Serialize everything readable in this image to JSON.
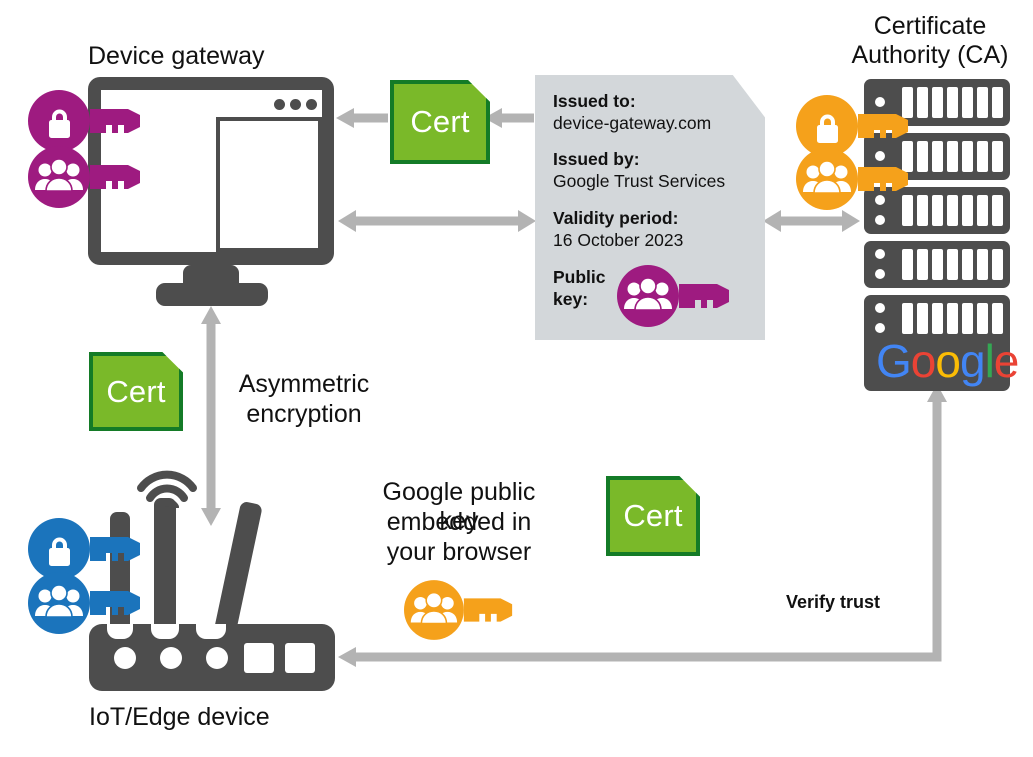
{
  "diagram": {
    "title_device_gateway": "Device gateway",
    "title_ca_line1": "Certificate",
    "title_ca_line2": "Authority (CA)",
    "label_iot_device": "IoT/Edge device",
    "label_asymmetric_line1": "Asymmetric",
    "label_asymmetric_line2": "encryption",
    "label_google_key_line1": "Google public key",
    "label_google_key_line2": "embedded in",
    "label_google_key_line3": "your browser",
    "label_verify_trust": "Verify trust"
  },
  "cert_badges": {
    "label": "Cert",
    "count": 3
  },
  "certificate": {
    "issued_to_label": "Issued to:",
    "issued_to_value": "device-gateway.com",
    "issued_by_label": "Issued by:",
    "issued_by_value": "Google Trust Services",
    "validity_label": "Validity period:",
    "validity_value": "16 October 2023",
    "public_key_label_line1": "Public",
    "public_key_label_line2": "key:"
  },
  "google_logo": {
    "letters": [
      {
        "char": "G",
        "color": "#4285F4"
      },
      {
        "char": "o",
        "color": "#EA4335"
      },
      {
        "char": "o",
        "color": "#FBBC05"
      },
      {
        "char": "g",
        "color": "#4285F4"
      },
      {
        "char": "l",
        "color": "#34A853"
      },
      {
        "char": "e",
        "color": "#EA4335"
      }
    ]
  },
  "keys": {
    "gateway_private": {
      "type": "lock-key",
      "color": "#9E1B80"
    },
    "gateway_public": {
      "type": "people-key",
      "color": "#9E1B80"
    },
    "ca_private": {
      "type": "lock-key",
      "color": "#F5A11B"
    },
    "ca_public": {
      "type": "people-key",
      "color": "#F5A11B"
    },
    "iot_private": {
      "type": "lock-key",
      "color": "#1B74BC"
    },
    "iot_public": {
      "type": "people-key",
      "color": "#1B74BC"
    },
    "cert_public": {
      "type": "people-key",
      "color": "#9E1B80"
    },
    "browser_public": {
      "type": "people-key",
      "color": "#F5A11B"
    }
  },
  "colors": {
    "purple": "#9E1B80",
    "orange": "#F5A11B",
    "blue": "#1B74BC",
    "green_fill": "#7AB929",
    "green_border": "#147B27",
    "dark_grey": "#4D4D4D",
    "arrow_grey": "#B3B3B3",
    "panel_grey": "#D3D7DA"
  }
}
